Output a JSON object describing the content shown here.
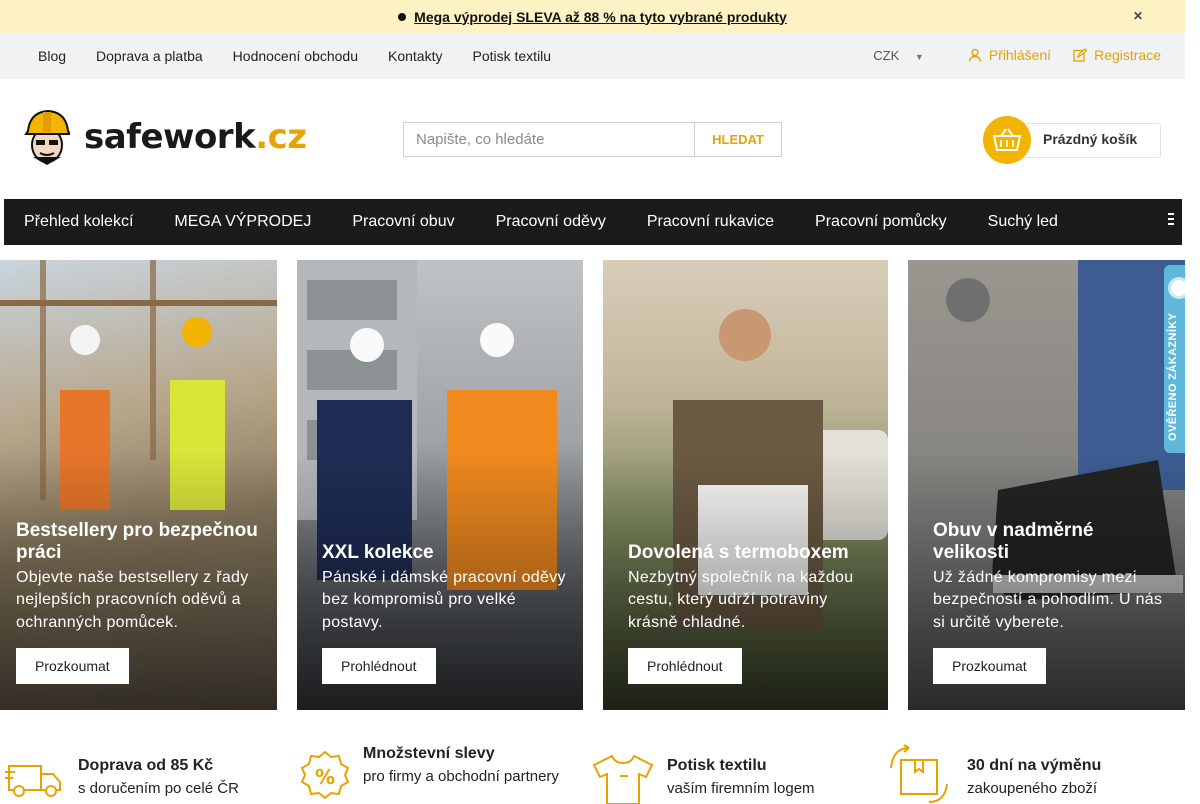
{
  "announcement": {
    "text": "Mega výprodej SLEVA až 88 % na tyto vybrané produkty"
  },
  "topnav": {
    "links": [
      "Blog",
      "Doprava a platba",
      "Hodnocení obchodu",
      "Kontakty",
      "Potisk textilu"
    ],
    "currency": "CZK",
    "login": "Přihlášení",
    "register": "Registrace"
  },
  "header": {
    "logo_main": "safework",
    "logo_tld": ".cz",
    "search_placeholder": "Napište, co hledáte",
    "search_button": "HLEDAT",
    "cart_label": "Prázdný košík"
  },
  "menu": [
    "Přehled kolekcí",
    "MEGA VÝPRODEJ",
    "Pracovní obuv",
    "Pracovní oděvy",
    "Pracovní rukavice",
    "Pracovní pomůcky",
    "Suchý led"
  ],
  "banners": [
    {
      "title": "Bestsellery pro bezpečnou práci",
      "text": "Objevte naše bestsellery z řady nejlepších pracovních oděvů a ochranných pomůcek.",
      "button": "Prozkoumat"
    },
    {
      "title": "XXL kolekce",
      "text": "Pánské i dámské pracovní oděvy bez kompromisů pro velké postavy.",
      "button": "Prohlédnout"
    },
    {
      "title": "Dovolená s termoboxem",
      "text": "Nezbytný společník na každou cestu, který udrží potraviny krásně chladné.",
      "button": "Prohlédnout"
    },
    {
      "title": "Obuv v nadměrné velikosti",
      "text": "Už žádné kompromisy mezi bezpečností a pohodlím. U nás si určitě vyberete.",
      "button": "Prozkoumat"
    }
  ],
  "trust_badge": "OVĚŘENO ZÁKAZNÍKY",
  "benefits": [
    {
      "title": "Doprava od 85 Kč",
      "text": "s doručením po celé ČR"
    },
    {
      "title": "Množstevní slevy",
      "text": "pro firmy a obchodní partnery"
    },
    {
      "title": "Potisk textilu",
      "text": "vaším firemním logem"
    },
    {
      "title": "30 dní na výměnu",
      "text": "zakoupeného zboží"
    }
  ],
  "colors": {
    "accent": "#e8a300",
    "menu_bg": "#1b1b1b",
    "announce_bg": "#fdf2c4"
  }
}
